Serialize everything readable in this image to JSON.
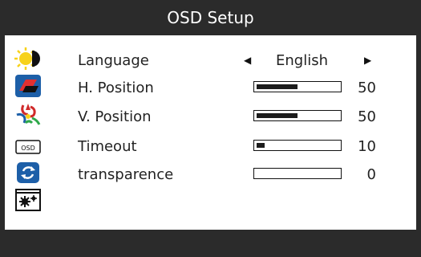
{
  "header": {
    "title": "OSD Setup"
  },
  "sidebar": {
    "items": [
      {
        "icon": "brightness-icon"
      },
      {
        "icon": "image-icon"
      },
      {
        "icon": "color-icon"
      },
      {
        "icon": "osd-icon",
        "label": "OSD",
        "selected": true
      },
      {
        "icon": "reset-icon"
      },
      {
        "icon": "settings-icon"
      }
    ]
  },
  "menu": {
    "language": {
      "label": "Language",
      "value": "English",
      "left_arrow": "◀",
      "right_arrow": "▶"
    },
    "h_position": {
      "label": "H. Position",
      "value": "50",
      "level": 0.5
    },
    "v_position": {
      "label": "V. Position",
      "value": "50",
      "level": 0.5
    },
    "timeout": {
      "label": "Timeout",
      "value": "10",
      "level": 0.1
    },
    "transparence": {
      "label": "transparence",
      "value": "0",
      "level": 0
    }
  },
  "colors": {
    "background": "#2b2b2b",
    "panel": "#ffffff",
    "bar_fill": "#1c1c1c",
    "accent_blue": "#1d5fa8",
    "accent_red": "#d02a2a",
    "accent_yellow": "#f7d21a"
  }
}
